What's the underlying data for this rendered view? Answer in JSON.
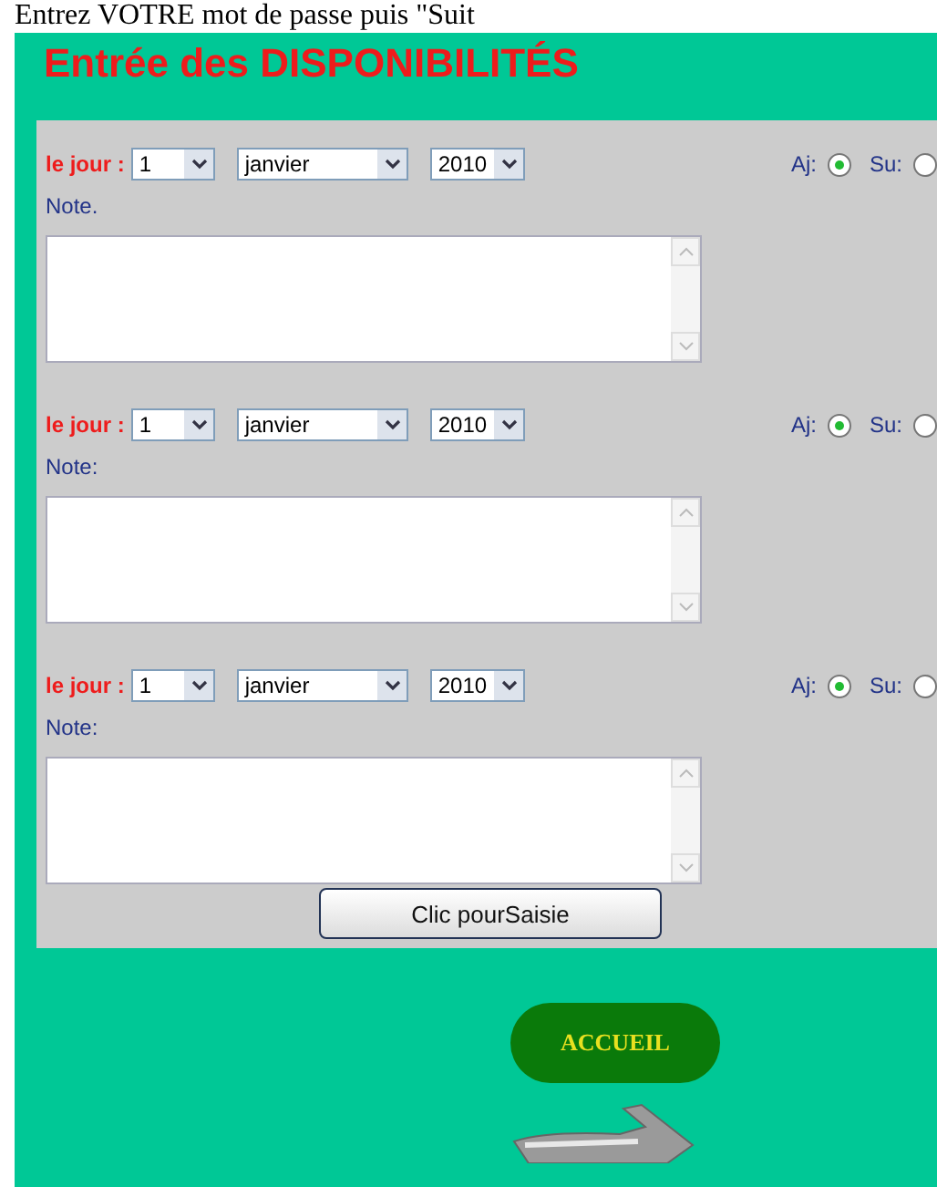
{
  "page_heading": "Entrez VOTRE mot de passe puis \"Suit",
  "title": "Entrée des DISPONIBILITÉS",
  "entries": [
    {
      "day_label": "le jour :",
      "day": "1",
      "month": "janvier",
      "year": "2010",
      "note_label": "Note.",
      "options": [
        {
          "label": "Aj:",
          "selected": true
        },
        {
          "label": "Su:",
          "selected": false
        }
      ]
    },
    {
      "day_label": "le jour :",
      "day": "1",
      "month": "janvier",
      "year": "2010",
      "note_label": "Note:",
      "options": [
        {
          "label": "Aj:",
          "selected": true
        },
        {
          "label": "Su:",
          "selected": false
        }
      ]
    },
    {
      "day_label": "le jour :",
      "day": "1",
      "month": "janvier",
      "year": "2010",
      "note_label": "Note:",
      "options": [
        {
          "label": "Aj:",
          "selected": true
        },
        {
          "label": "Su:",
          "selected": false
        }
      ]
    }
  ],
  "submit_button": "Clic pourSaisie",
  "home_button": "ACCUEIL"
}
